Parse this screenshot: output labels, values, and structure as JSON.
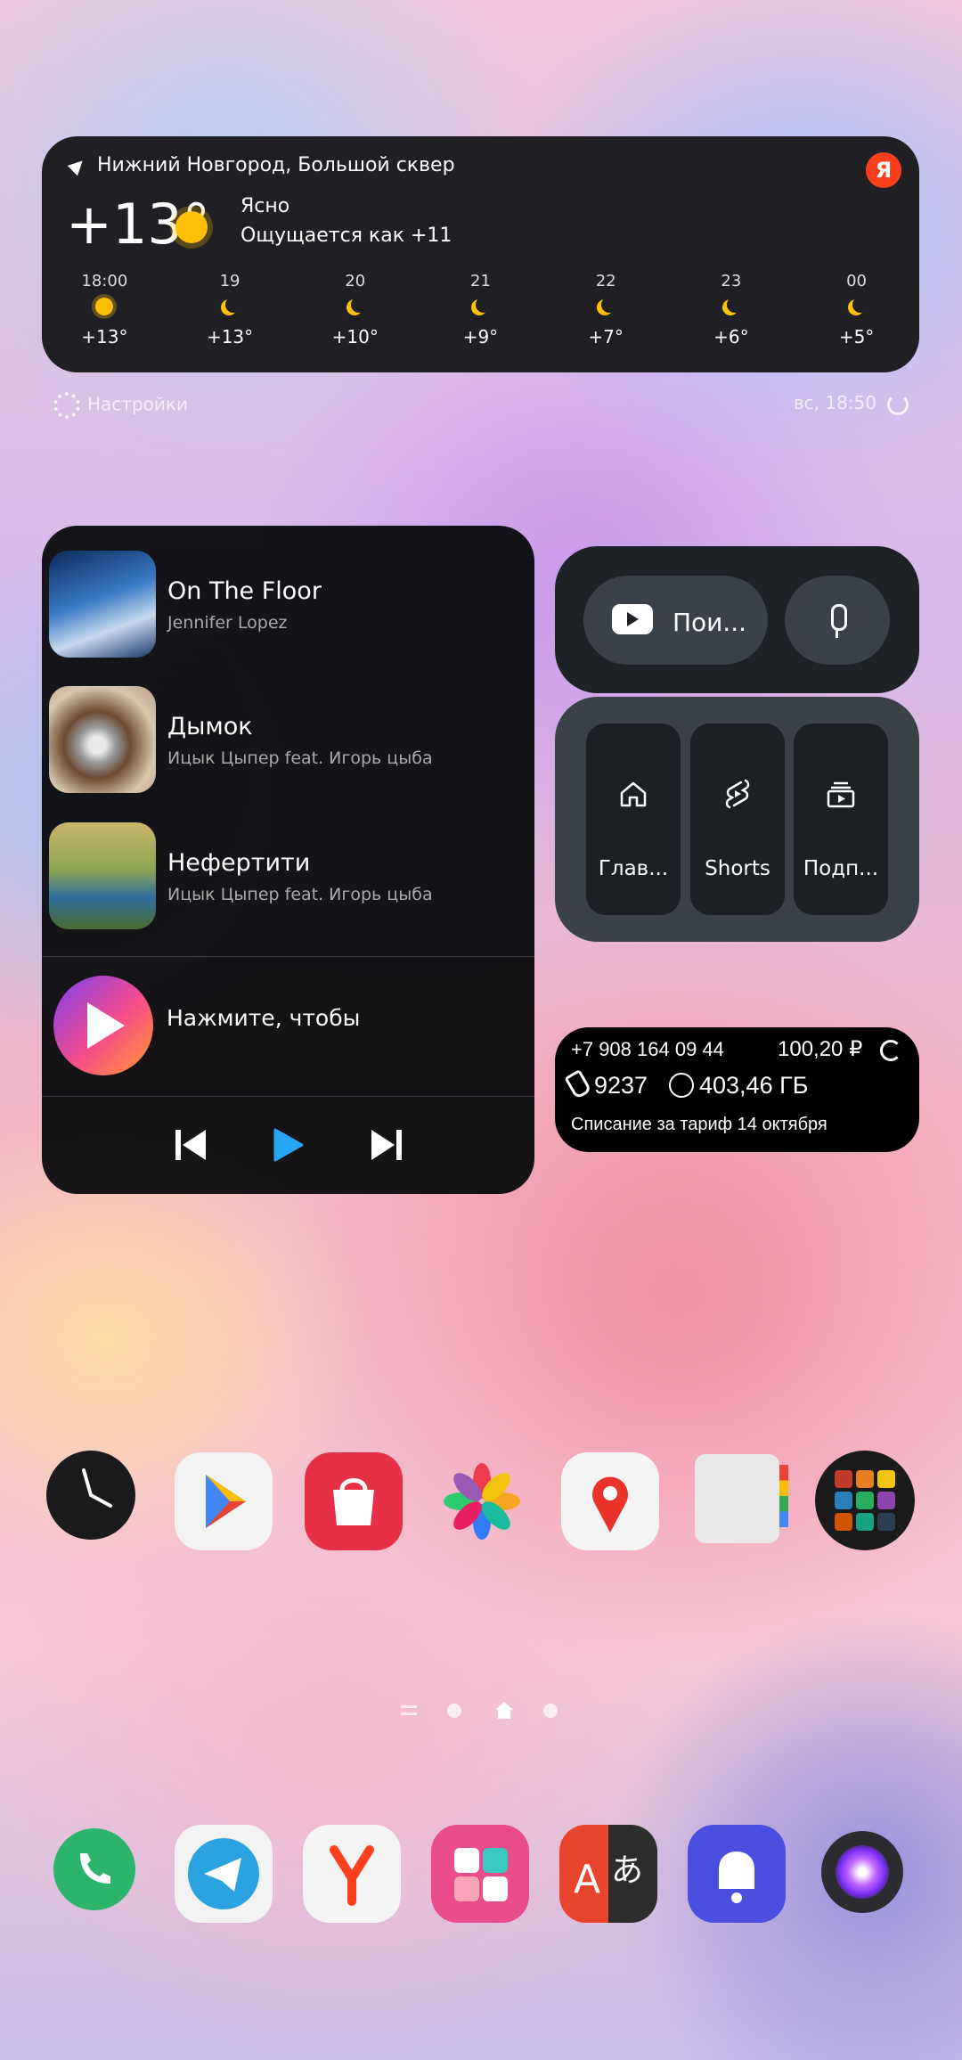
{
  "weather": {
    "location": "Нижний Новгород, Большой сквер",
    "provider_badge": "Я",
    "temp": "+13°",
    "condition": "Ясно",
    "feels_like": "Ощущается как +11",
    "hourly": [
      {
        "time": "18:00",
        "icon": "sun-icon",
        "temp": "+13°"
      },
      {
        "time": "19",
        "icon": "moon-icon",
        "temp": "+13°"
      },
      {
        "time": "20",
        "icon": "moon-icon",
        "temp": "+10°"
      },
      {
        "time": "21",
        "icon": "moon-icon",
        "temp": "+9°"
      },
      {
        "time": "22",
        "icon": "moon-icon",
        "temp": "+7°"
      },
      {
        "time": "23",
        "icon": "moon-icon",
        "temp": "+6°"
      },
      {
        "time": "00",
        "icon": "moon-icon",
        "temp": "+5°"
      }
    ],
    "settings_label": "Настройки",
    "updated": "вс, 18:50"
  },
  "music": {
    "tracks": [
      {
        "title": "On The Floor",
        "artist": "Jennifer Lopez"
      },
      {
        "title": "Дымок",
        "artist": "Ицык Цыпер feat. Игорь цыба"
      },
      {
        "title": "Нефертити",
        "artist": "Ицык Цыпер feat. Игорь цыба"
      }
    ],
    "player_hint": "Нажмите, чтобы"
  },
  "youtube": {
    "search_label": "Пои...",
    "tabs": [
      {
        "label": "Глав..."
      },
      {
        "label": "Shorts"
      },
      {
        "label": "Подп..."
      }
    ]
  },
  "mobile": {
    "phone_number": "+7 908 164 09 44",
    "balance": "100,20 ₽",
    "minutes": "9237",
    "data": "403,46 ГБ",
    "charge_note": "Списание за тариф 14 октября"
  },
  "colors": {
    "youtube_red": "#ff0000",
    "yandex_red": "#fc3f1d",
    "weather_sun": "#ffc107"
  },
  "apps_row1": [
    "clock-icon",
    "google-play-icon",
    "store-bag-icon",
    "photos-flower-icon",
    "maps-pin-icon",
    "notes-icon",
    "app-folder-icon"
  ],
  "apps_row2": [
    "phone-icon",
    "telegram-icon",
    "yandex-browser-icon",
    "gallery-app-icon",
    "translate-icon",
    "notifications-bell-icon",
    "camera-icon"
  ]
}
